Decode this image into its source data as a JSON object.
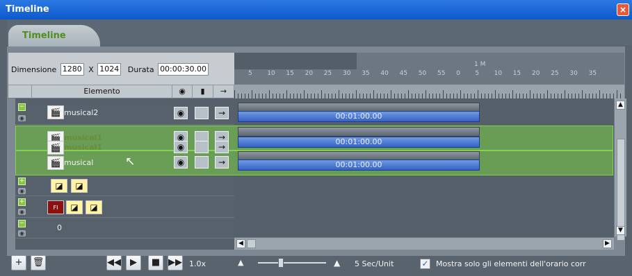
{
  "window": {
    "title": "Timeline",
    "close_label": "×"
  },
  "tab": {
    "label": "Timeline"
  },
  "dimension": {
    "label": "Dimensione",
    "width": "1280",
    "times": "X",
    "height": "1024",
    "duration_label": "Durata",
    "duration": "00:00:30.00"
  },
  "ruler": {
    "numbers": [
      "5",
      "10",
      "15",
      "20",
      "25",
      "30",
      "35",
      "40",
      "45",
      "50",
      "55",
      "0",
      "5",
      "10",
      "15",
      "20",
      "25",
      "30",
      "35"
    ],
    "minute_mark": "1 M"
  },
  "header": {
    "element_label": "Elemento",
    "eye_icon": "eye-icon",
    "lock_icon": "lock-icon",
    "arrow": "→"
  },
  "rows": [
    {
      "name": "musical2",
      "time": "00:01:00.00"
    },
    {
      "name": "musical1",
      "time": "00:01:00.00"
    },
    {
      "name": "musical1",
      "time": ""
    },
    {
      "name": "musical",
      "time": "00:01:00.00"
    },
    {
      "name": "",
      "time": ""
    },
    {
      "name": "",
      "time": ""
    },
    {
      "name": "0",
      "time": ""
    }
  ],
  "footer": {
    "speed": "1.0x",
    "unit": "5 Sec/Unit",
    "checkbox_label": "Mostra solo gli elementi dell'orario corr"
  }
}
